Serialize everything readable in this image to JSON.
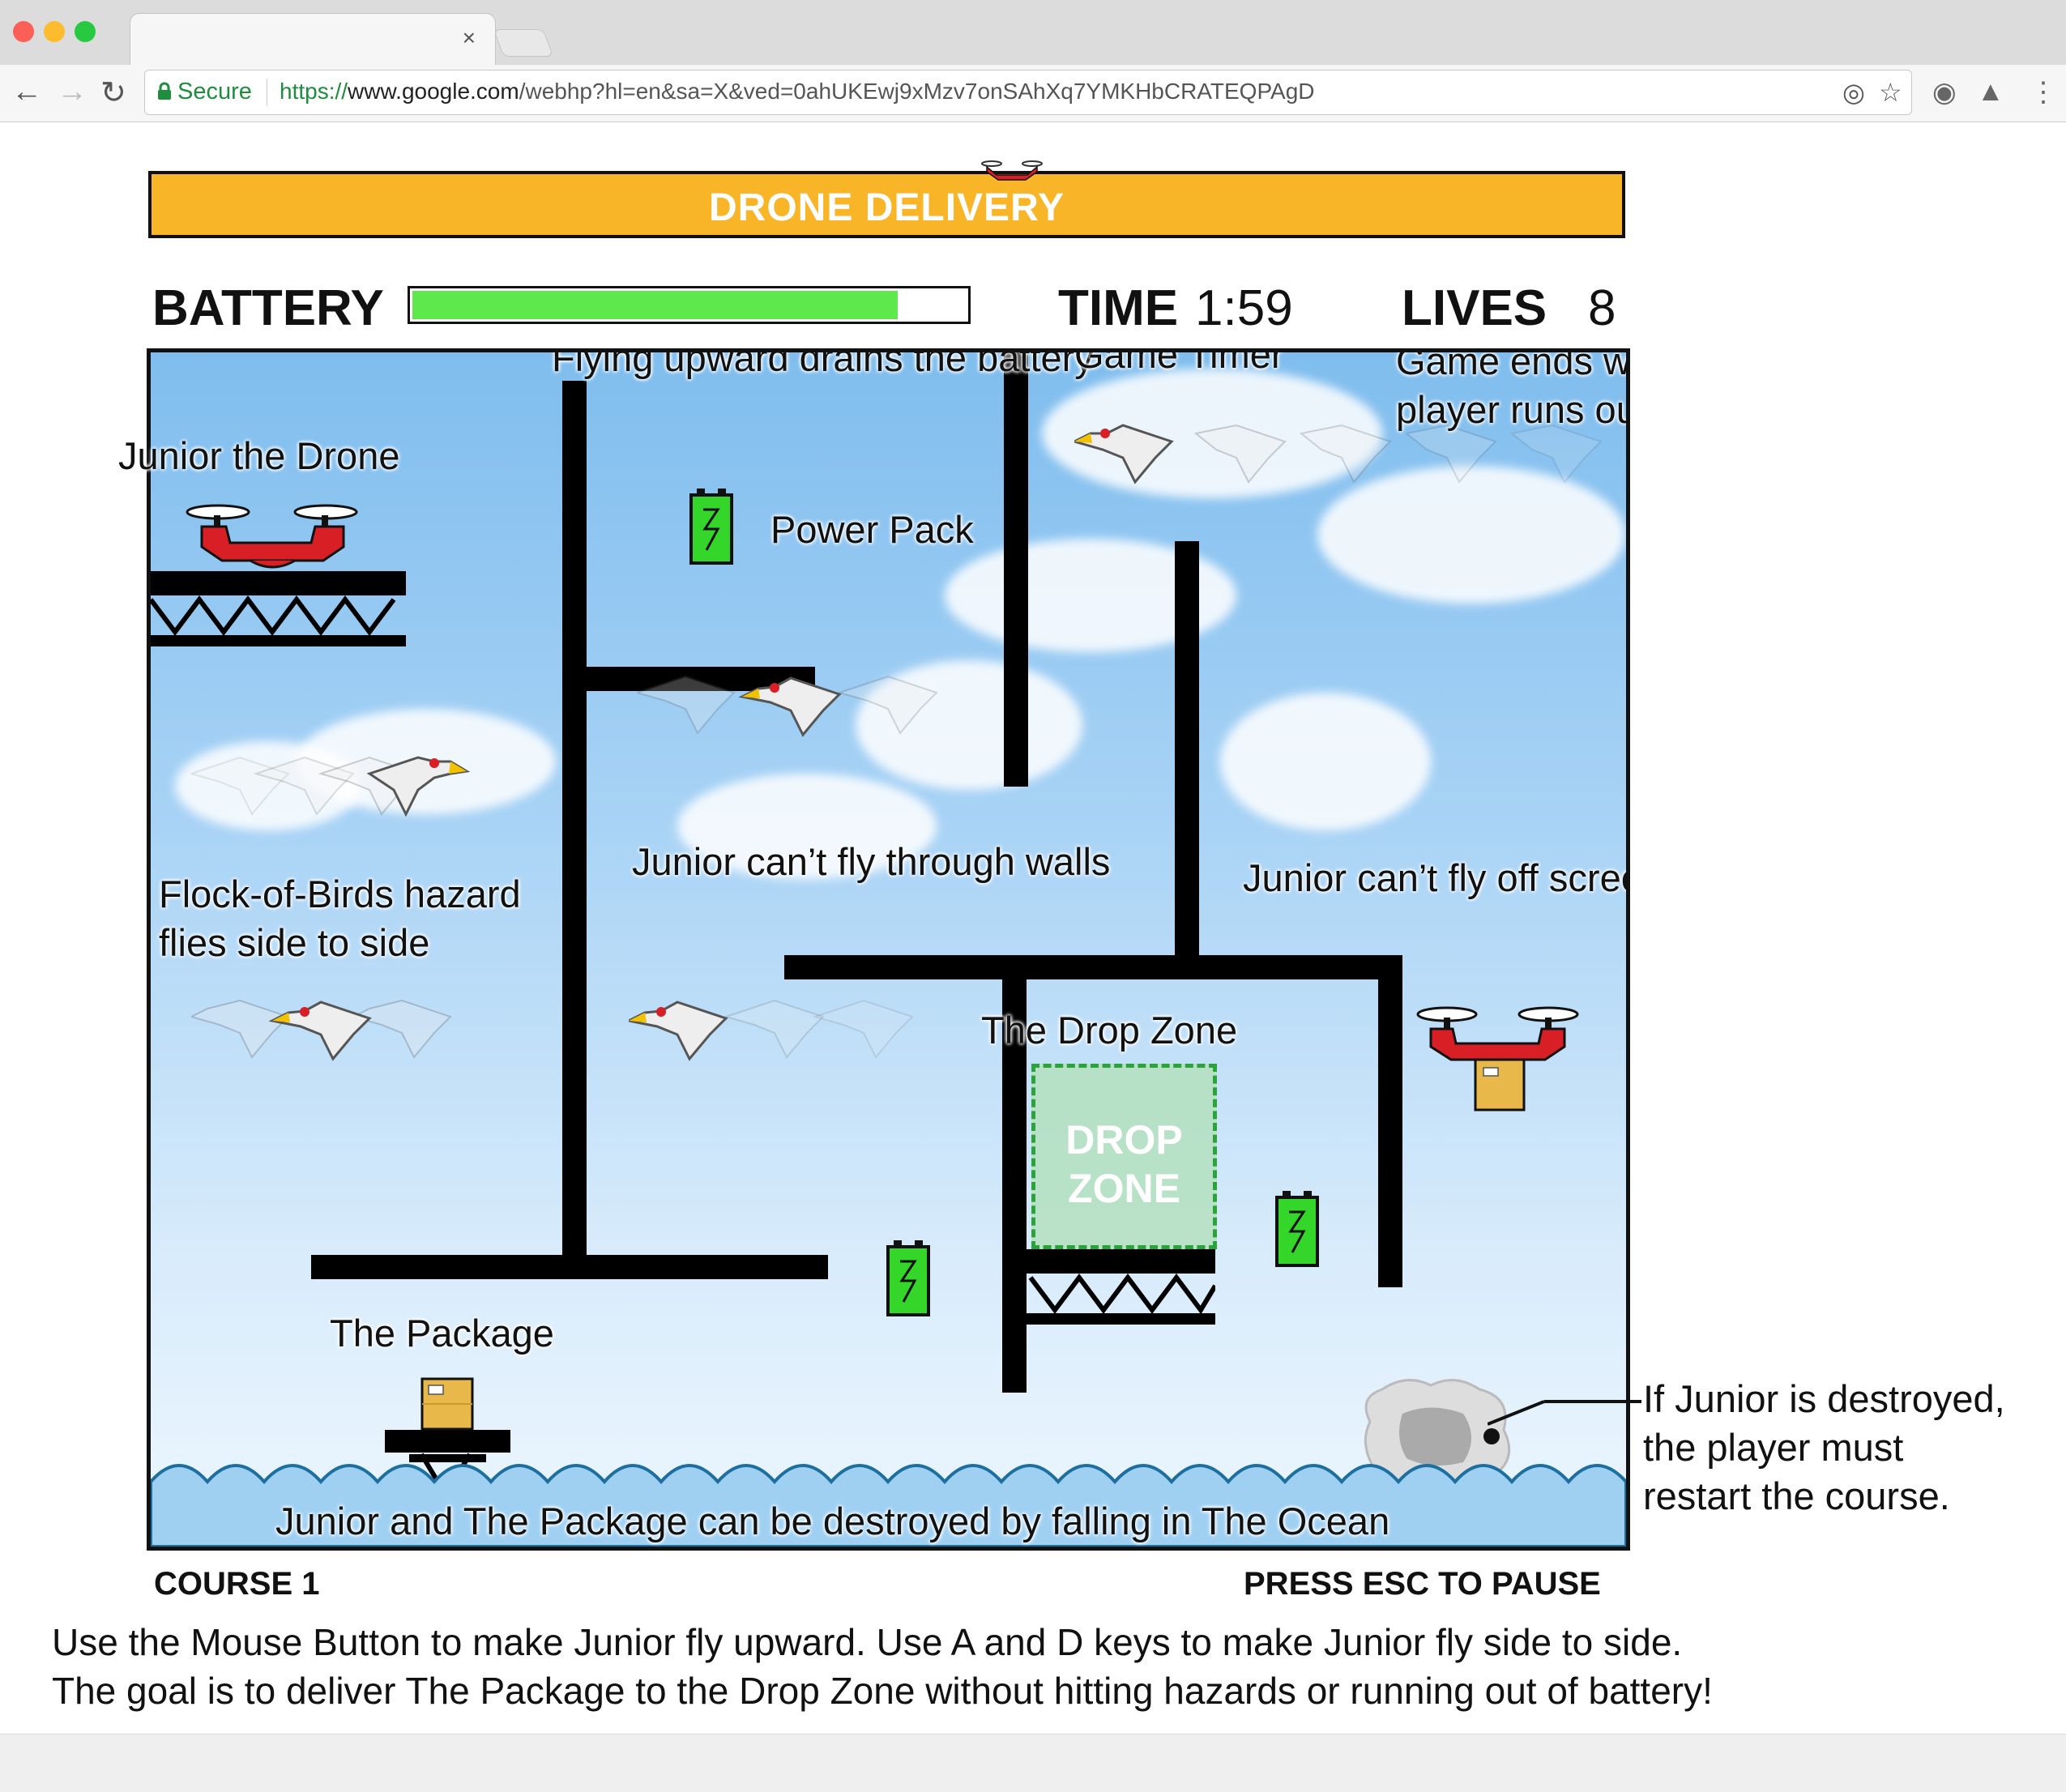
{
  "browser": {
    "tab_close": "×",
    "secure_label": "Secure",
    "url_scheme": "https://",
    "url_host": "www.google.com",
    "url_path": "/webhp?hl=en&sa=X&ved=0ahUKEwj9xMzv7onSAhXq7YMKHbCRATEQPAgD",
    "icons": [
      "back-icon",
      "forward-icon",
      "reload-icon",
      "lock-icon",
      "target-icon",
      "star-icon",
      "extension-icon",
      "drive-icon",
      "menu-icon"
    ]
  },
  "game": {
    "title": "DRONE DELIVERY",
    "battery_label": "BATTERY",
    "battery_level": 0.87,
    "time_label": "TIME",
    "time_value": "1:59",
    "lives_label": "LIVES",
    "lives_value": "8",
    "drop_zone_line1": "DROP",
    "drop_zone_line2": "ZONE",
    "course_label": "COURSE 1",
    "pause_label": "PRESS ESC TO PAUSE",
    "colors": {
      "banner": "#f8b528",
      "battery_fill": "#5ee84c",
      "drone": "#d81f26",
      "power_pack": "#35d62a",
      "drop_zone_border": "#2aa33a",
      "ocean": "#1d6fa0"
    }
  },
  "annotations": {
    "battery": "Flying upward drains the battery",
    "timer": "Game Timer",
    "lives_line1": "Game ends when",
    "lives_line2": "player runs out of lives",
    "drone": "Junior the Drone",
    "power_pack": "Power Pack",
    "walls": "Junior can’t fly through walls",
    "offscreen": "Junior can’t fly off screen",
    "birds_line1": "Flock-of-Birds hazard",
    "birds_line2": "flies side to side",
    "drop_zone": "The Drop Zone",
    "package": "The Package",
    "ocean": "Junior and The Package can be destroyed by falling in The Ocean",
    "destroyed_line1": "If Junior is destroyed,",
    "destroyed_line2": "the player must",
    "destroyed_line3": "restart the course."
  },
  "instructions": {
    "line1": "Use the Mouse Button to make Junior fly upward. Use A and D keys to make Junior fly side to side.",
    "line2": "The goal is to deliver The Package to the Drop Zone without hitting hazards or running out of battery!"
  }
}
